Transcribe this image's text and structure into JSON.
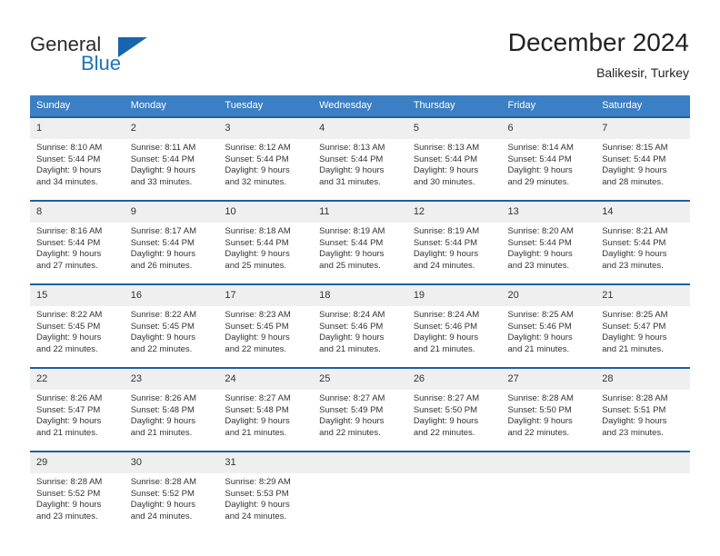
{
  "brand": {
    "name_part1": "General",
    "name_part2": "Blue",
    "accent_color": "#1565b0",
    "triangle_icon": "triangle-icon"
  },
  "header": {
    "title": "December 2024",
    "subtitle": "Balikesir, Turkey"
  },
  "calendar": {
    "header_bg": "#3b7fc4",
    "separator_color": "#1d5fa3",
    "daynum_bg": "#efefef",
    "weekdays": [
      "Sunday",
      "Monday",
      "Tuesday",
      "Wednesday",
      "Thursday",
      "Friday",
      "Saturday"
    ],
    "weeks": [
      [
        {
          "day": "1",
          "sunrise": "Sunrise: 8:10 AM",
          "sunset": "Sunset: 5:44 PM",
          "daylight1": "Daylight: 9 hours",
          "daylight2": "and 34 minutes."
        },
        {
          "day": "2",
          "sunrise": "Sunrise: 8:11 AM",
          "sunset": "Sunset: 5:44 PM",
          "daylight1": "Daylight: 9 hours",
          "daylight2": "and 33 minutes."
        },
        {
          "day": "3",
          "sunrise": "Sunrise: 8:12 AM",
          "sunset": "Sunset: 5:44 PM",
          "daylight1": "Daylight: 9 hours",
          "daylight2": "and 32 minutes."
        },
        {
          "day": "4",
          "sunrise": "Sunrise: 8:13 AM",
          "sunset": "Sunset: 5:44 PM",
          "daylight1": "Daylight: 9 hours",
          "daylight2": "and 31 minutes."
        },
        {
          "day": "5",
          "sunrise": "Sunrise: 8:13 AM",
          "sunset": "Sunset: 5:44 PM",
          "daylight1": "Daylight: 9 hours",
          "daylight2": "and 30 minutes."
        },
        {
          "day": "6",
          "sunrise": "Sunrise: 8:14 AM",
          "sunset": "Sunset: 5:44 PM",
          "daylight1": "Daylight: 9 hours",
          "daylight2": "and 29 minutes."
        },
        {
          "day": "7",
          "sunrise": "Sunrise: 8:15 AM",
          "sunset": "Sunset: 5:44 PM",
          "daylight1": "Daylight: 9 hours",
          "daylight2": "and 28 minutes."
        }
      ],
      [
        {
          "day": "8",
          "sunrise": "Sunrise: 8:16 AM",
          "sunset": "Sunset: 5:44 PM",
          "daylight1": "Daylight: 9 hours",
          "daylight2": "and 27 minutes."
        },
        {
          "day": "9",
          "sunrise": "Sunrise: 8:17 AM",
          "sunset": "Sunset: 5:44 PM",
          "daylight1": "Daylight: 9 hours",
          "daylight2": "and 26 minutes."
        },
        {
          "day": "10",
          "sunrise": "Sunrise: 8:18 AM",
          "sunset": "Sunset: 5:44 PM",
          "daylight1": "Daylight: 9 hours",
          "daylight2": "and 25 minutes."
        },
        {
          "day": "11",
          "sunrise": "Sunrise: 8:19 AM",
          "sunset": "Sunset: 5:44 PM",
          "daylight1": "Daylight: 9 hours",
          "daylight2": "and 25 minutes."
        },
        {
          "day": "12",
          "sunrise": "Sunrise: 8:19 AM",
          "sunset": "Sunset: 5:44 PM",
          "daylight1": "Daylight: 9 hours",
          "daylight2": "and 24 minutes."
        },
        {
          "day": "13",
          "sunrise": "Sunrise: 8:20 AM",
          "sunset": "Sunset: 5:44 PM",
          "daylight1": "Daylight: 9 hours",
          "daylight2": "and 23 minutes."
        },
        {
          "day": "14",
          "sunrise": "Sunrise: 8:21 AM",
          "sunset": "Sunset: 5:44 PM",
          "daylight1": "Daylight: 9 hours",
          "daylight2": "and 23 minutes."
        }
      ],
      [
        {
          "day": "15",
          "sunrise": "Sunrise: 8:22 AM",
          "sunset": "Sunset: 5:45 PM",
          "daylight1": "Daylight: 9 hours",
          "daylight2": "and 22 minutes."
        },
        {
          "day": "16",
          "sunrise": "Sunrise: 8:22 AM",
          "sunset": "Sunset: 5:45 PM",
          "daylight1": "Daylight: 9 hours",
          "daylight2": "and 22 minutes."
        },
        {
          "day": "17",
          "sunrise": "Sunrise: 8:23 AM",
          "sunset": "Sunset: 5:45 PM",
          "daylight1": "Daylight: 9 hours",
          "daylight2": "and 22 minutes."
        },
        {
          "day": "18",
          "sunrise": "Sunrise: 8:24 AM",
          "sunset": "Sunset: 5:46 PM",
          "daylight1": "Daylight: 9 hours",
          "daylight2": "and 21 minutes."
        },
        {
          "day": "19",
          "sunrise": "Sunrise: 8:24 AM",
          "sunset": "Sunset: 5:46 PM",
          "daylight1": "Daylight: 9 hours",
          "daylight2": "and 21 minutes."
        },
        {
          "day": "20",
          "sunrise": "Sunrise: 8:25 AM",
          "sunset": "Sunset: 5:46 PM",
          "daylight1": "Daylight: 9 hours",
          "daylight2": "and 21 minutes."
        },
        {
          "day": "21",
          "sunrise": "Sunrise: 8:25 AM",
          "sunset": "Sunset: 5:47 PM",
          "daylight1": "Daylight: 9 hours",
          "daylight2": "and 21 minutes."
        }
      ],
      [
        {
          "day": "22",
          "sunrise": "Sunrise: 8:26 AM",
          "sunset": "Sunset: 5:47 PM",
          "daylight1": "Daylight: 9 hours",
          "daylight2": "and 21 minutes."
        },
        {
          "day": "23",
          "sunrise": "Sunrise: 8:26 AM",
          "sunset": "Sunset: 5:48 PM",
          "daylight1": "Daylight: 9 hours",
          "daylight2": "and 21 minutes."
        },
        {
          "day": "24",
          "sunrise": "Sunrise: 8:27 AM",
          "sunset": "Sunset: 5:48 PM",
          "daylight1": "Daylight: 9 hours",
          "daylight2": "and 21 minutes."
        },
        {
          "day": "25",
          "sunrise": "Sunrise: 8:27 AM",
          "sunset": "Sunset: 5:49 PM",
          "daylight1": "Daylight: 9 hours",
          "daylight2": "and 22 minutes."
        },
        {
          "day": "26",
          "sunrise": "Sunrise: 8:27 AM",
          "sunset": "Sunset: 5:50 PM",
          "daylight1": "Daylight: 9 hours",
          "daylight2": "and 22 minutes."
        },
        {
          "day": "27",
          "sunrise": "Sunrise: 8:28 AM",
          "sunset": "Sunset: 5:50 PM",
          "daylight1": "Daylight: 9 hours",
          "daylight2": "and 22 minutes."
        },
        {
          "day": "28",
          "sunrise": "Sunrise: 8:28 AM",
          "sunset": "Sunset: 5:51 PM",
          "daylight1": "Daylight: 9 hours",
          "daylight2": "and 23 minutes."
        }
      ],
      [
        {
          "day": "29",
          "sunrise": "Sunrise: 8:28 AM",
          "sunset": "Sunset: 5:52 PM",
          "daylight1": "Daylight: 9 hours",
          "daylight2": "and 23 minutes."
        },
        {
          "day": "30",
          "sunrise": "Sunrise: 8:28 AM",
          "sunset": "Sunset: 5:52 PM",
          "daylight1": "Daylight: 9 hours",
          "daylight2": "and 24 minutes."
        },
        {
          "day": "31",
          "sunrise": "Sunrise: 8:29 AM",
          "sunset": "Sunset: 5:53 PM",
          "daylight1": "Daylight: 9 hours",
          "daylight2": "and 24 minutes."
        },
        {
          "day": "",
          "sunrise": "",
          "sunset": "",
          "daylight1": "",
          "daylight2": ""
        },
        {
          "day": "",
          "sunrise": "",
          "sunset": "",
          "daylight1": "",
          "daylight2": ""
        },
        {
          "day": "",
          "sunrise": "",
          "sunset": "",
          "daylight1": "",
          "daylight2": ""
        },
        {
          "day": "",
          "sunrise": "",
          "sunset": "",
          "daylight1": "",
          "daylight2": ""
        }
      ]
    ]
  }
}
